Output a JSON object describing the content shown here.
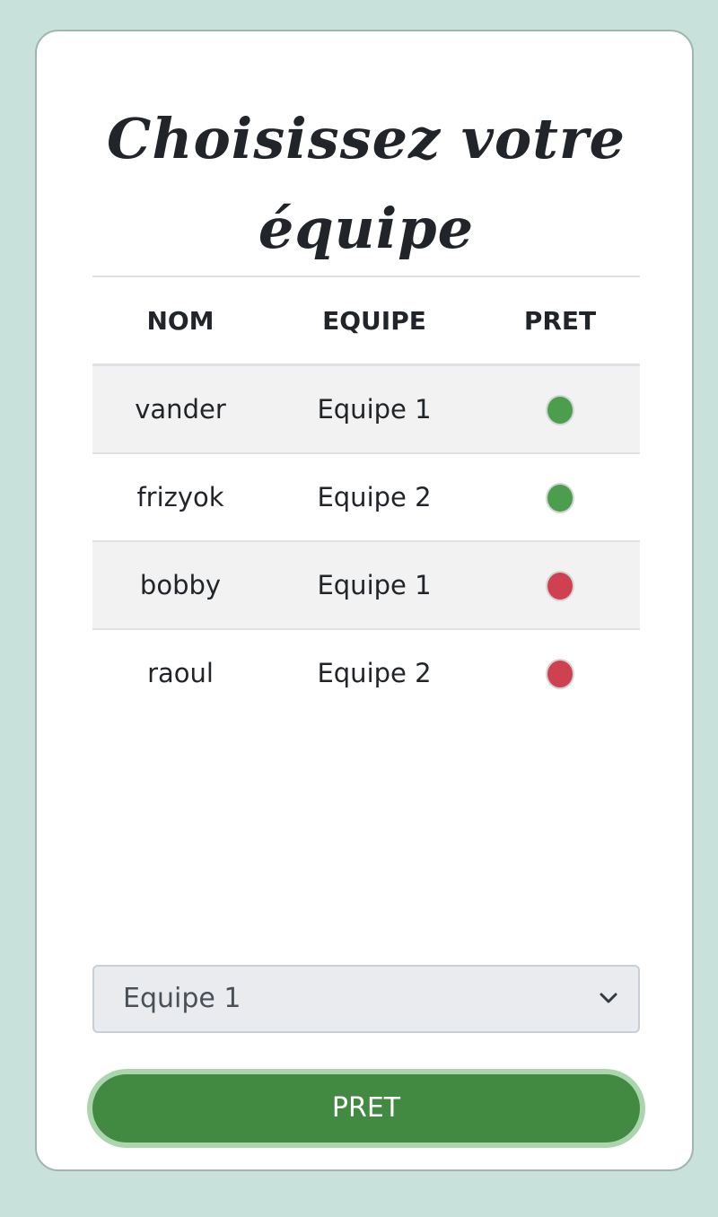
{
  "title": "Choisissez votre équipe",
  "table": {
    "headers": [
      "NOM",
      "EQUIPE",
      "PRET"
    ],
    "rows": [
      {
        "nom": "vander",
        "equipe": "Equipe 1",
        "pret": true
      },
      {
        "nom": "frizyok",
        "equipe": "Equipe 2",
        "pret": true
      },
      {
        "nom": "bobby",
        "equipe": "Equipe 1",
        "pret": false
      },
      {
        "nom": "raoul",
        "equipe": "Equipe 2",
        "pret": false
      }
    ]
  },
  "status_colors": {
    "ready": "#4c9e4e",
    "not_ready": "#cf4150"
  },
  "team_select": {
    "value": "Equipe 1",
    "icon": "chevron-down-icon"
  },
  "ready_button": {
    "label": "PRET"
  },
  "colors": {
    "page_background": "#c8e1db",
    "button": "#428a42",
    "button_ring": "#abd6ad"
  }
}
